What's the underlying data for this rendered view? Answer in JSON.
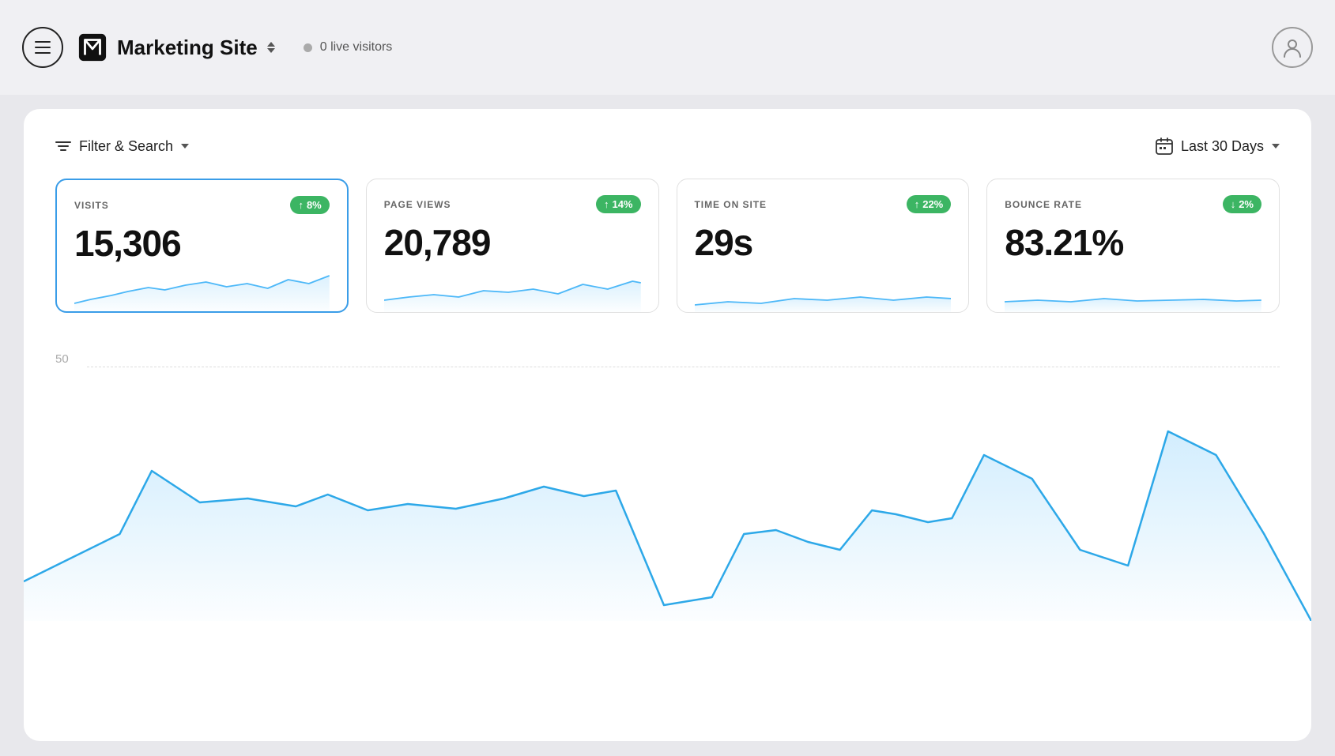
{
  "header": {
    "menu_label": "menu",
    "site_name": "Marketing Site",
    "live_visitors_label": "0 live visitors",
    "live_dot_color": "#aaa"
  },
  "toolbar": {
    "filter_label": "Filter & Search",
    "date_label": "Last 30 Days"
  },
  "metrics": [
    {
      "id": "visits",
      "label": "VISITS",
      "value": "15,306",
      "badge_value": "8%",
      "badge_type": "up",
      "active": true
    },
    {
      "id": "page_views",
      "label": "PAGE VIEWS",
      "value": "20,789",
      "badge_value": "14%",
      "badge_type": "up",
      "active": false
    },
    {
      "id": "time_on_site",
      "label": "TIME ON SITE",
      "value": "29s",
      "badge_value": "22%",
      "badge_type": "up",
      "active": false
    },
    {
      "id": "bounce_rate",
      "label": "BOUNCE RATE",
      "value": "83.21%",
      "badge_value": "2%",
      "badge_type": "down",
      "active": false
    }
  ],
  "chart": {
    "y_label": "50"
  }
}
